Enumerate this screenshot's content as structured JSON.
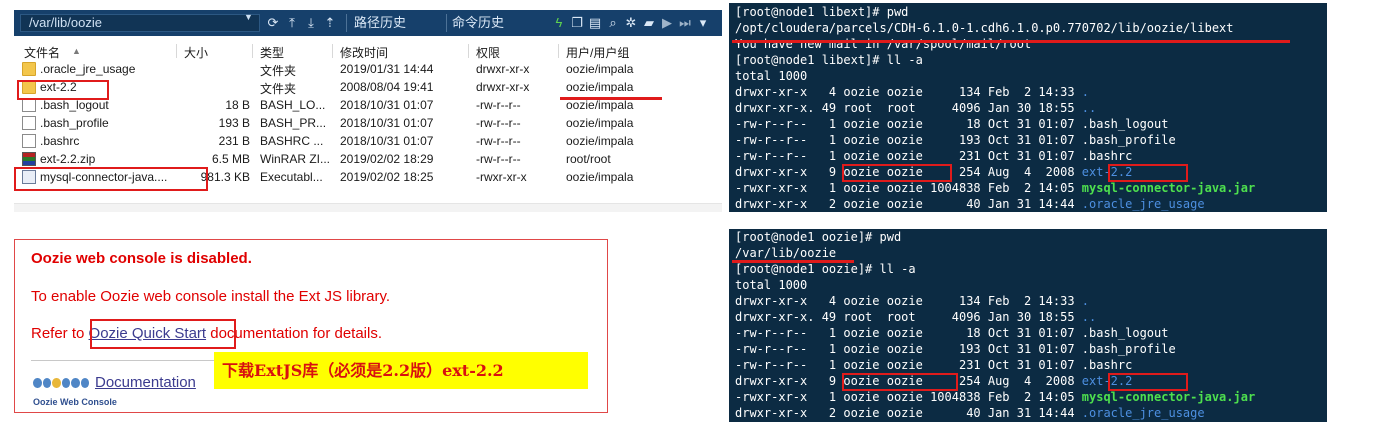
{
  "file_manager": {
    "path": "/var/lib/oozie",
    "path_history_label": "路径历史",
    "command_history_label": "命令历史",
    "toolbar_icons": [
      "refresh-icon",
      "upload-icon",
      "download-icon",
      "go-up-icon"
    ],
    "right_icons": [
      "lightning-icon",
      "copy-icon",
      "file-icon",
      "search-icon",
      "gear-icon",
      "folder-icon",
      "play-icon",
      "next-icon",
      "chevron-down-icon"
    ],
    "columns": [
      "文件名",
      "大小",
      "类型",
      "修改时间",
      "权限",
      "用户/用户组"
    ],
    "sort_arrow": "▲",
    "rows": [
      {
        "icon": "folder",
        "name": ".oracle_jre_usage",
        "size": "",
        "type": "文件夹",
        "mtime": "2019/01/31 14:44",
        "perm": "drwxr-xr-x",
        "owner": "oozie/impala"
      },
      {
        "icon": "folder",
        "name": "ext-2.2",
        "size": "",
        "type": "文件夹",
        "mtime": "2008/08/04 19:41",
        "perm": "drwxr-xr-x",
        "owner": "oozie/impala"
      },
      {
        "icon": "doc",
        "name": ".bash_logout",
        "size": "18 B",
        "type": "BASH_LO...",
        "mtime": "2018/10/31 01:07",
        "perm": "-rw-r--r--",
        "owner": "oozie/impala"
      },
      {
        "icon": "doc",
        "name": ".bash_profile",
        "size": "193 B",
        "type": "BASH_PR...",
        "mtime": "2018/10/31 01:07",
        "perm": "-rw-r--r--",
        "owner": "oozie/impala"
      },
      {
        "icon": "doc",
        "name": ".bashrc",
        "size": "231 B",
        "type": "BASHRC ...",
        "mtime": "2018/10/31 01:07",
        "perm": "-rw-r--r--",
        "owner": "oozie/impala"
      },
      {
        "icon": "zip",
        "name": "ext-2.2.zip",
        "size": "6.5 MB",
        "type": "WinRAR ZI...",
        "mtime": "2019/02/02 18:29",
        "perm": "-rw-r--r--",
        "owner": "root/root"
      },
      {
        "icon": "jar",
        "name": "mysql-connector-java....",
        "size": "981.3 KB",
        "type": "Executabl...",
        "mtime": "2019/02/02 18:25",
        "perm": "-rwxr-xr-x",
        "owner": "oozie/impala"
      }
    ]
  },
  "web_console": {
    "title": "Oozie web console is disabled.",
    "line1": "To enable Oozie web console install the Ext JS library.",
    "line2_prefix": "Refer to ",
    "line2_link": "Oozie Quick Start",
    "line2_suffix": " documentation for details.",
    "doc_link": "Documentation",
    "logo_caption": "Oozie Web Console",
    "note": "下载ExtJS库（必须是2.2版）ext-2.2"
  },
  "terminal_top": {
    "lines": [
      "[root@node1 libext]# pwd",
      "/opt/cloudera/parcels/CDH-6.1.0-1.cdh6.1.0.p0.770702/lib/oozie/libext",
      "You have new mail in /var/spool/mail/root",
      "[root@node1 libext]# ll -a",
      "total 1000"
    ],
    "entries": [
      {
        "meta": "drwxr-xr-x   4 oozie oozie     134 Feb  2 14:33 ",
        "name": ".",
        "style": "blue"
      },
      {
        "meta": "drwxr-xr-x. 49 root  root     4096 Jan 30 18:55 ",
        "name": "..",
        "style": "blue"
      },
      {
        "meta": "-rw-r--r--   1 oozie oozie      18 Oct 31 01:07 ",
        "name": ".bash_logout",
        "style": "plain"
      },
      {
        "meta": "-rw-r--r--   1 oozie oozie     193 Oct 31 01:07 ",
        "name": ".bash_profile",
        "style": "plain"
      },
      {
        "meta": "-rw-r--r--   1 oozie oozie     231 Oct 31 01:07 ",
        "name": ".bashrc",
        "style": "plain"
      },
      {
        "meta": "drwxr-xr-x   9 oozie oozie     254 Aug  4  2008 ",
        "name": "ext-2.2",
        "style": "blue"
      },
      {
        "meta": "-rwxr-xr-x   1 oozie oozie 1004838 Feb  2 14:05 ",
        "name": "mysql-connector-java.jar",
        "style": "green"
      },
      {
        "meta": "drwxr-xr-x   2 oozie oozie      40 Jan 31 14:44 ",
        "name": ".oracle_jre_usage",
        "style": "blue"
      }
    ]
  },
  "terminal_bottom": {
    "lines": [
      "[root@node1 oozie]# pwd",
      "/var/lib/oozie",
      "[root@node1 oozie]# ll -a",
      "total 1000"
    ],
    "entries": [
      {
        "meta": "drwxr-xr-x   4 oozie oozie     134 Feb  2 14:33 ",
        "name": ".",
        "style": "blue"
      },
      {
        "meta": "drwxr-xr-x. 49 root  root     4096 Jan 30 18:55 ",
        "name": "..",
        "style": "blue"
      },
      {
        "meta": "-rw-r--r--   1 oozie oozie      18 Oct 31 01:07 ",
        "name": ".bash_logout",
        "style": "plain"
      },
      {
        "meta": "-rw-r--r--   1 oozie oozie     193 Oct 31 01:07 ",
        "name": ".bash_profile",
        "style": "plain"
      },
      {
        "meta": "-rw-r--r--   1 oozie oozie     231 Oct 31 01:07 ",
        "name": ".bashrc",
        "style": "plain"
      },
      {
        "meta": "drwxr-xr-x   9 oozie oozie     254 Aug  4  2008 ",
        "name": "ext-2.2",
        "style": "blue"
      },
      {
        "meta": "-rwxr-xr-x   1 oozie oozie 1004838 Feb  2 14:05 ",
        "name": "mysql-connector-java.jar",
        "style": "green"
      },
      {
        "meta": "drwxr-xr-x   2 oozie oozie      40 Jan 31 14:44 ",
        "name": ".oracle_jre_usage",
        "style": "blue"
      }
    ]
  },
  "colors": {
    "terminal_bg": "#0c2b43",
    "annotation_red": "#e01b1b",
    "note_yellow": "#ffff00",
    "toolbar_bg": "#16406b"
  }
}
